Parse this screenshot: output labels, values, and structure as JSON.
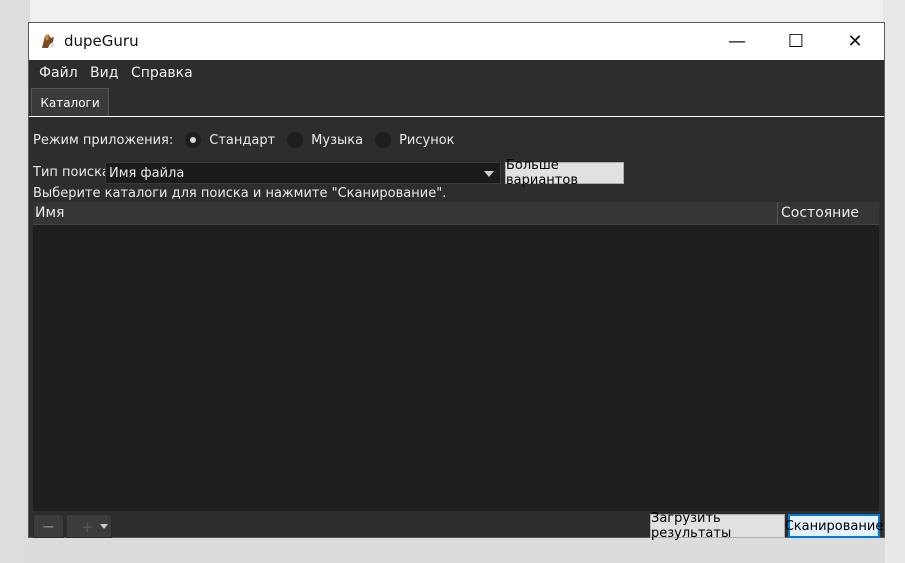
{
  "window": {
    "title": "dupeGuru",
    "controls": {
      "minimize": "—",
      "maximize": "☐",
      "close": "✕"
    }
  },
  "menu": {
    "items": [
      "Файл",
      "Вид",
      "Справка"
    ]
  },
  "tabs": [
    {
      "label": "Каталоги",
      "active": true
    }
  ],
  "mode": {
    "label": "Режим приложения:",
    "options": [
      {
        "label": "Стандарт",
        "checked": true
      },
      {
        "label": "Музыка",
        "checked": false
      },
      {
        "label": "Рисунок",
        "checked": false
      }
    ]
  },
  "search": {
    "label": "Тип поиска:",
    "value": "Имя файла",
    "more_label": "Больше вариантов"
  },
  "hint": "Выберите каталоги для поиска и нажмите \"Сканирование\".",
  "table": {
    "columns": [
      "Имя",
      "Состояние"
    ],
    "rows": []
  },
  "bottom": {
    "remove_label": "−",
    "add_label": "+",
    "load_label": "Загрузить результаты",
    "scan_label": "Сканирование"
  },
  "colors": {
    "accent": "#0078d7",
    "background": "#2d2d2d",
    "list_bg": "#1e1e1e"
  }
}
